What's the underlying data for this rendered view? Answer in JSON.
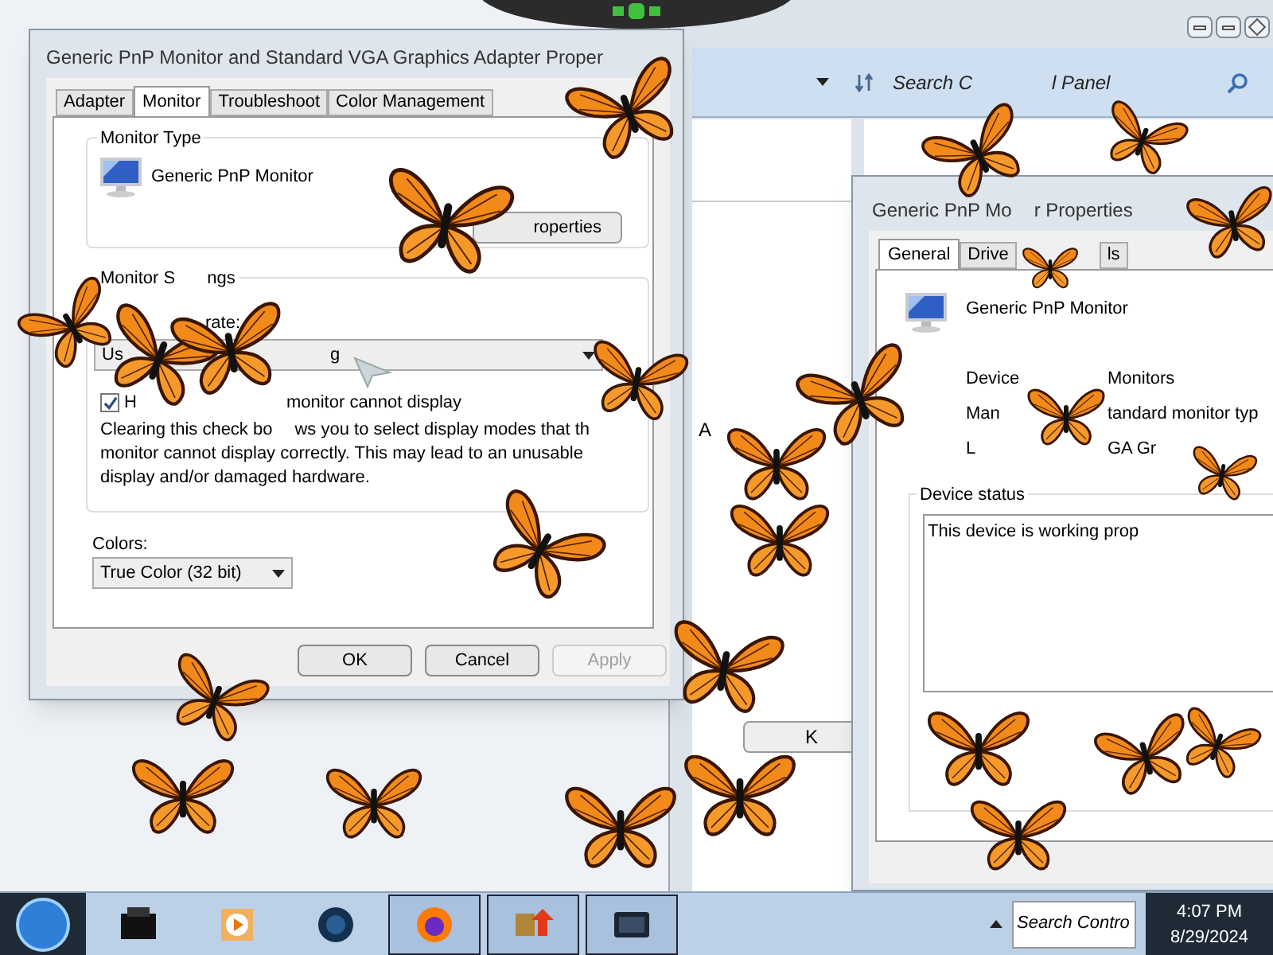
{
  "background_window": {
    "search": {
      "placeholder_parts": [
        "Search C",
        "l Panel"
      ]
    },
    "fragment_text": "A",
    "fragment_button": "K"
  },
  "display_dialog": {
    "title": "Generic PnP Monitor and Standard VGA Graphics Adapter Proper",
    "tabs": [
      {
        "label": "Adapter",
        "selected": false
      },
      {
        "label": "Monitor",
        "selected": true
      },
      {
        "label": "Troubleshoot",
        "selected": false
      },
      {
        "label": "Color Management",
        "selected": false
      }
    ],
    "monitor_type": {
      "label": "Monitor Type",
      "name": "Generic PnP Monitor",
      "button": "roperties"
    },
    "monitor_settings": {
      "label_parts": [
        "Monitor S",
        "ngs"
      ],
      "refresh_label": "rate:",
      "refresh_value_parts": [
        "Us",
        "g"
      ],
      "hide_modes": {
        "label_parts": [
          "H",
          "monitor cannot display"
        ],
        "checked": true
      },
      "description_lines": [
        [
          "Clearing this check bo",
          "ws you to select display modes that th"
        ],
        [
          "monitor cannot display correctly. This may lead to an unusable"
        ],
        [
          "display and/or damaged hardware."
        ]
      ]
    },
    "colors": {
      "label": "Colors:",
      "value": "True Color (32 bit)"
    },
    "buttons": [
      {
        "label": "OK",
        "disabled": false
      },
      {
        "label": "Cancel",
        "disabled": false
      },
      {
        "label": "Apply",
        "disabled": true
      }
    ]
  },
  "monitor_dialog": {
    "title_parts": [
      "Generic PnP Mo",
      "r Properties"
    ],
    "tabs": [
      {
        "label": "General",
        "selected": true
      },
      {
        "label": "Drive",
        "selected": false
      },
      {
        "label": "ls",
        "selected": false
      }
    ],
    "name": "Generic PnP Monitor",
    "rows": [
      {
        "label": "Device",
        "value": "Monitors"
      },
      {
        "label": "Man",
        "value": "tandard monitor typ"
      },
      {
        "label": "L",
        "value": "GA Gr"
      }
    ],
    "status_label": "Device status",
    "status_text": "This device is working prop"
  },
  "taskbar": {
    "preview_text": "Search Contro",
    "time": "4:07 PM",
    "date": "8/29/2024"
  }
}
